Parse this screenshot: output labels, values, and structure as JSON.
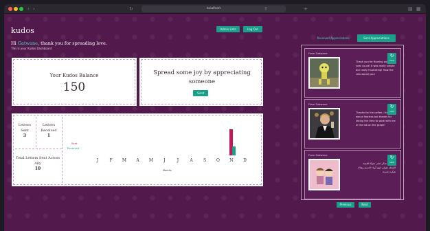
{
  "browser": {
    "url": "localhost",
    "nav_icons": [
      "back-icon",
      "forward-icon",
      "reload-icon"
    ]
  },
  "header": {
    "logo": "kudos",
    "buttons": [
      "Admin Lists",
      "Log Out"
    ]
  },
  "greeting": {
    "prefix": "Hi ",
    "name": "Gatwane",
    "suffix": ", thank you for spreading love.",
    "sub": "This is your Kudos Dashboard"
  },
  "balance": {
    "label": "Your Kudos Balance",
    "value": "150"
  },
  "spread": {
    "text": "Spread some joy by appreciating someone",
    "button": "Send"
  },
  "stats": {
    "sent_label": "Letters Sent",
    "sent_value": "3",
    "received_label": "Letters Received",
    "received_value": "1",
    "total_label": "Total Letters Sent Across Ally",
    "total_value": "10"
  },
  "chart_data": {
    "type": "bar",
    "categories": [
      "J",
      "F",
      "M",
      "A",
      "M",
      "J",
      "J",
      "A",
      "S",
      "O",
      "N",
      "D"
    ],
    "series": [
      {
        "name": "Sent",
        "color": "#c2185b",
        "values": [
          0,
          0,
          0,
          0,
          0,
          0,
          0,
          0,
          0,
          0,
          3,
          0
        ]
      },
      {
        "name": "Received",
        "color": "#1aa08a",
        "values": [
          0,
          0,
          0,
          0,
          0,
          0,
          0,
          0,
          0,
          0,
          1,
          0
        ]
      }
    ],
    "xlabel": "Months",
    "ylim": [
      0,
      3
    ]
  },
  "tabs": {
    "received": "Received Appreciations",
    "sent": "Sent Appreciations"
  },
  "feed": {
    "posts": [
      {
        "author": "From Gatwane",
        "text": "Thank you for flooring out last year count! It was really simple but really frustrating! How the rats would you!",
        "icon_label": "Like"
      },
      {
        "author": "From Gatwane",
        "text": "Thanks for the coffee, I know it was a fearless but thanks for taking the time to work with me in the lab on the graph!",
        "icon_label": "Like"
      },
      {
        "author": "From Gatwane",
        "text": "حب وان شکر اعلی شوکا الغيمة الشغله تقولي انهم أوباء الدسم وهناك شكره جديدة",
        "icon_label": "Like"
      }
    ],
    "pagination": [
      "Previous",
      "Next"
    ]
  }
}
